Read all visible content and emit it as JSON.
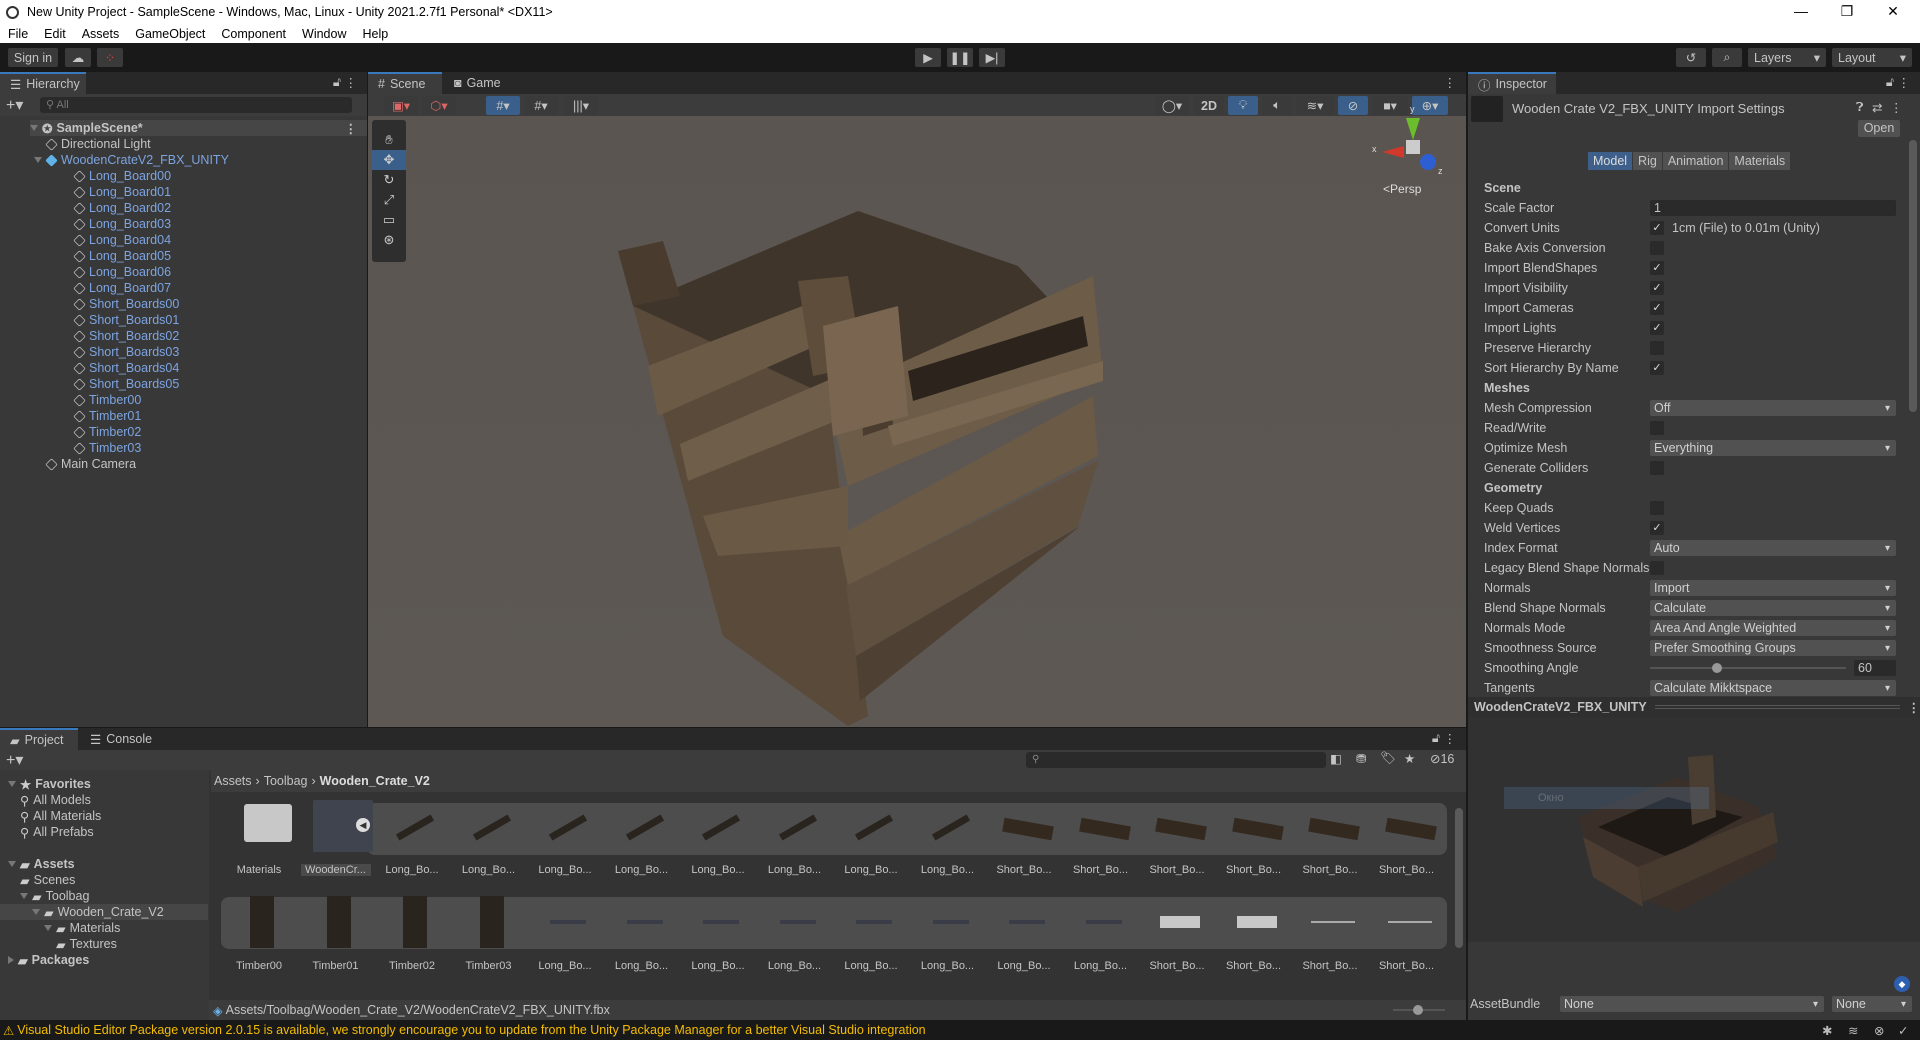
{
  "window": {
    "title": "New Unity Project - SampleScene - Windows, Mac, Linux - Unity 2021.2.7f1 Personal* <DX11>"
  },
  "menu": [
    "File",
    "Edit",
    "Assets",
    "GameObject",
    "Component",
    "Window",
    "Help"
  ],
  "toolbar": {
    "sign_in": "Sign in",
    "layers": "Layers",
    "layout": "Layout"
  },
  "hierarchy": {
    "tab": "Hierarchy",
    "search_placeholder": "All",
    "scene": "SampleScene*",
    "items": [
      {
        "label": "Directional Light",
        "level": 1,
        "prefab": false
      },
      {
        "label": "WoodenCrateV2_FBX_UNITY",
        "level": 1,
        "prefab": true,
        "expanded": true
      },
      {
        "label": "Long_Board00",
        "level": 2,
        "prefab": true
      },
      {
        "label": "Long_Board01",
        "level": 2,
        "prefab": true
      },
      {
        "label": "Long_Board02",
        "level": 2,
        "prefab": true
      },
      {
        "label": "Long_Board03",
        "level": 2,
        "prefab": true
      },
      {
        "label": "Long_Board04",
        "level": 2,
        "prefab": true
      },
      {
        "label": "Long_Board05",
        "level": 2,
        "prefab": true
      },
      {
        "label": "Long_Board06",
        "level": 2,
        "prefab": true
      },
      {
        "label": "Long_Board07",
        "level": 2,
        "prefab": true
      },
      {
        "label": "Short_Boards00",
        "level": 2,
        "prefab": true
      },
      {
        "label": "Short_Boards01",
        "level": 2,
        "prefab": true
      },
      {
        "label": "Short_Boards02",
        "level": 2,
        "prefab": true
      },
      {
        "label": "Short_Boards03",
        "level": 2,
        "prefab": true
      },
      {
        "label": "Short_Boards04",
        "level": 2,
        "prefab": true
      },
      {
        "label": "Short_Boards05",
        "level": 2,
        "prefab": true
      },
      {
        "label": "Timber00",
        "level": 2,
        "prefab": true
      },
      {
        "label": "Timber01",
        "level": 2,
        "prefab": true
      },
      {
        "label": "Timber02",
        "level": 2,
        "prefab": true
      },
      {
        "label": "Timber03",
        "level": 2,
        "prefab": true
      },
      {
        "label": "Main Camera",
        "level": 1,
        "prefab": false
      }
    ]
  },
  "scene": {
    "tabs": [
      "Scene",
      "Game"
    ],
    "btn_2d": "2D",
    "gizmo": {
      "x": "x",
      "y": "y",
      "z": "z",
      "persp": "Persp"
    }
  },
  "inspector": {
    "tab": "Inspector",
    "title": "Wooden Crate V2_FBX_UNITY Import Settings",
    "open": "Open",
    "tabs": [
      "Model",
      "Rig",
      "Animation",
      "Materials"
    ],
    "active_tab": "Model",
    "fields": [
      {
        "type": "header",
        "label": "Scene"
      },
      {
        "type": "text",
        "label": "Scale Factor",
        "value": "1"
      },
      {
        "type": "check",
        "label": "Convert Units",
        "checked": true,
        "note": "1cm (File) to 0.01m (Unity)"
      },
      {
        "type": "check",
        "label": "Bake Axis Conversion",
        "checked": false
      },
      {
        "type": "check",
        "label": "Import BlendShapes",
        "checked": true
      },
      {
        "type": "check",
        "label": "Import Visibility",
        "checked": true
      },
      {
        "type": "check",
        "label": "Import Cameras",
        "checked": true
      },
      {
        "type": "check",
        "label": "Import Lights",
        "checked": true
      },
      {
        "type": "check",
        "label": "Preserve Hierarchy",
        "checked": false
      },
      {
        "type": "check",
        "label": "Sort Hierarchy By Name",
        "checked": true
      },
      {
        "type": "header",
        "label": "Meshes"
      },
      {
        "type": "dropdown",
        "label": "Mesh Compression",
        "value": "Off"
      },
      {
        "type": "check",
        "label": "Read/Write",
        "checked": false
      },
      {
        "type": "dropdown",
        "label": "Optimize Mesh",
        "value": "Everything"
      },
      {
        "type": "check",
        "label": "Generate Colliders",
        "checked": false
      },
      {
        "type": "header",
        "label": "Geometry"
      },
      {
        "type": "check",
        "label": "Keep Quads",
        "checked": false
      },
      {
        "type": "check",
        "label": "Weld Vertices",
        "checked": true
      },
      {
        "type": "dropdown",
        "label": "Index Format",
        "value": "Auto"
      },
      {
        "type": "check",
        "label": "Legacy Blend Shape Normals",
        "checked": false
      },
      {
        "type": "dropdown",
        "label": "Normals",
        "value": "Import"
      },
      {
        "type": "dropdown",
        "label": "Blend Shape Normals",
        "value": "Calculate"
      },
      {
        "type": "dropdown",
        "label": "Normals Mode",
        "value": "Area And Angle Weighted"
      },
      {
        "type": "dropdown",
        "label": "Smoothness Source",
        "value": "Prefer Smoothing Groups"
      },
      {
        "type": "slider",
        "label": "Smoothing Angle",
        "value": "60",
        "fraction": 0.333
      },
      {
        "type": "dropdown",
        "label": "Tangents",
        "value": "Calculate Mikktspace"
      }
    ],
    "preview_title": "WoodenCrateV2_FBX_UNITY",
    "overlay_text": "Окно",
    "assetbundle_label": "AssetBundle",
    "assetbundle_value": "None",
    "assetbundle_variant": "None"
  },
  "project": {
    "tabs": [
      "Project",
      "Console"
    ],
    "tree": [
      {
        "label": "Favorites",
        "level": 0,
        "icon": "star",
        "bold": true
      },
      {
        "label": "All Models",
        "level": 1,
        "icon": "search"
      },
      {
        "label": "All Materials",
        "level": 1,
        "icon": "search"
      },
      {
        "label": "All Prefabs",
        "level": 1,
        "icon": "search"
      },
      {
        "label": "",
        "level": 0,
        "icon": "none"
      },
      {
        "label": "Assets",
        "level": 0,
        "icon": "folder",
        "bold": true
      },
      {
        "label": "Scenes",
        "level": 1,
        "icon": "folder"
      },
      {
        "label": "Toolbag",
        "level": 1,
        "icon": "folder"
      },
      {
        "label": "Wooden_Crate_V2",
        "level": 2,
        "icon": "folder",
        "selected": true
      },
      {
        "label": "Materials",
        "level": 3,
        "icon": "folder"
      },
      {
        "label": "Textures",
        "level": 4,
        "icon": "folder"
      },
      {
        "label": "Packages",
        "level": 0,
        "icon": "folder",
        "bold": true
      }
    ],
    "breadcrumb": [
      "Assets",
      "Toolbag",
      "Wooden_Crate_V2"
    ],
    "hidden_count": "16",
    "row1": [
      "Materials",
      "WoodenCr...",
      "Long_Bo...",
      "Long_Bo...",
      "Long_Bo...",
      "Long_Bo...",
      "Long_Bo...",
      "Long_Bo...",
      "Long_Bo...",
      "Long_Bo...",
      "Short_Bo...",
      "Short_Bo...",
      "Short_Bo...",
      "Short_Bo...",
      "Short_Bo...",
      "Short_Bo..."
    ],
    "row2": [
      "Timber00",
      "Timber01",
      "Timber02",
      "Timber03",
      "Long_Bo...",
      "Long_Bo...",
      "Long_Bo...",
      "Long_Bo...",
      "Long_Bo...",
      "Long_Bo...",
      "Long_Bo...",
      "Long_Bo...",
      "Short_Bo...",
      "Short_Bo...",
      "Short_Bo...",
      "Short_Bo..."
    ],
    "path": "Assets/Toolbag/Wooden_Crate_V2/WoodenCrateV2_FBX_UNITY.fbx"
  },
  "status": {
    "warning": "Visual Studio Editor Package version 2.0.15 is available, we strongly encourage you to update from the Unity Package Manager for a better Visual Studio integration"
  },
  "colors": {
    "accent": "#3a79bb",
    "warning": "#f4bc02",
    "prefab": "#7ca4e0"
  }
}
